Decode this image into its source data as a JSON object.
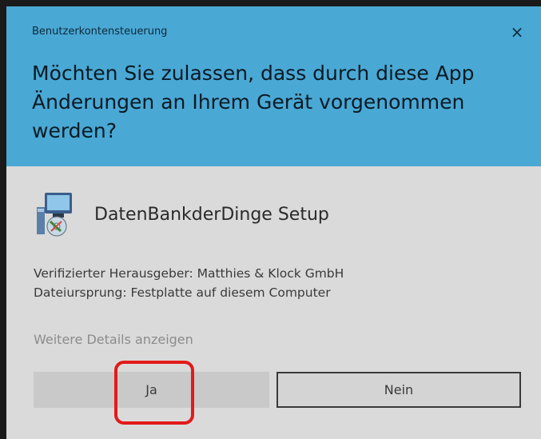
{
  "dialog": {
    "window_title": "Benutzerkontensteuerung",
    "question": "Möchten Sie zulassen, dass durch diese App Änderungen an Ihrem Gerät vorgenommen werden?",
    "close_glyph": "×"
  },
  "app": {
    "name": "DatenBankderDinge Setup",
    "icon": "setup-installer-icon"
  },
  "info": {
    "publisher": "Verifizierter Herausgeber: Matthies & Klock GmbH",
    "origin": "Dateiursprung: Festplatte auf diesem Computer"
  },
  "details_link": "Weitere Details anzeigen",
  "buttons": {
    "yes": "Ja",
    "no": "Nein"
  },
  "colors": {
    "header": "#4aa8d4",
    "body": "#dadada",
    "highlight": "#e21a1a"
  }
}
